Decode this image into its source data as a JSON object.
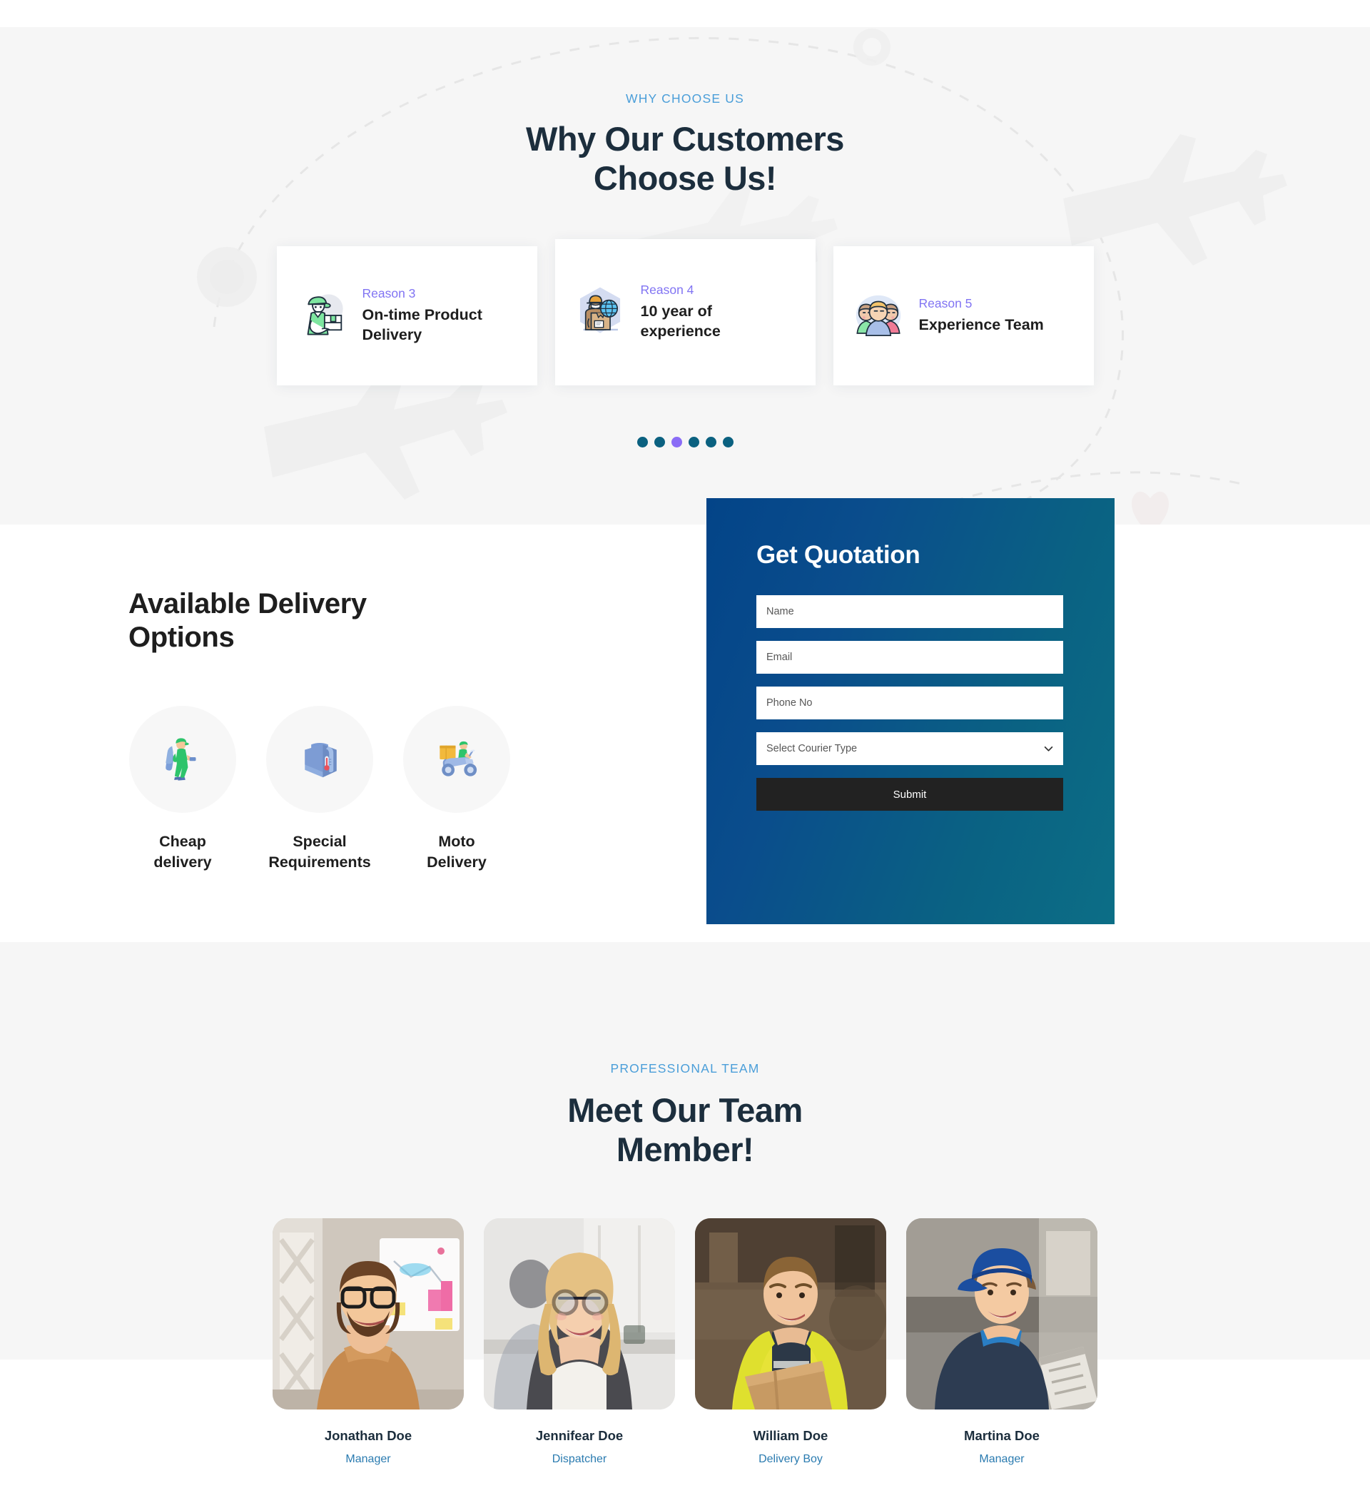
{
  "why_choose": {
    "eyebrow": "WHY CHOOSE US",
    "title_line1": "Why Our Customers",
    "title_line2": "Choose Us!",
    "cards": [
      {
        "label": "Reason 3",
        "title": "On-time Product Delivery",
        "icon": "courier-with-package-icon"
      },
      {
        "label": "Reason 4",
        "title": "10 year of experience",
        "icon": "worker-globe-package-icon"
      },
      {
        "label": "Reason 5",
        "title": "Experience Team",
        "icon": "team-people-icon"
      }
    ],
    "carousel": {
      "dot_count": 6,
      "active_index": 2,
      "dot_color": "#0b6180",
      "active_color": "#8a6cf6"
    }
  },
  "delivery_options": {
    "heading_line1": "Available Delivery",
    "heading_line2": "Options",
    "items": [
      {
        "label_line1": "Cheap",
        "label_line2": "delivery",
        "icon": "walking-courier-icon"
      },
      {
        "label_line1": "Special",
        "label_line2": "Requirements",
        "icon": "cooler-bag-icon"
      },
      {
        "label_line1": "Moto",
        "label_line2": "Delivery",
        "icon": "scooter-delivery-icon"
      }
    ]
  },
  "quotation": {
    "title": "Get Quotation",
    "fields": {
      "name_placeholder": "Name",
      "email_placeholder": "Email",
      "phone_placeholder": "Phone No",
      "courier_placeholder": "Select Courier Type"
    },
    "submit_label": "Submit",
    "gradient_from": "#034488",
    "gradient_to": "#0c6e86",
    "submit_bg": "#222222"
  },
  "team": {
    "eyebrow": "PROFESSIONAL TEAM",
    "title_line1": "Meet Our Team",
    "title_line2": "Member!",
    "members": [
      {
        "name": "Jonathan Doe",
        "role": "Manager",
        "photo": "bearded-man-glasses-office-photo"
      },
      {
        "name": "Jennifear Doe",
        "role": "Dispatcher",
        "photo": "blonde-woman-glasses-office-photo"
      },
      {
        "name": "William Doe",
        "role": "Delivery Boy",
        "photo": "man-hi-vis-vest-box-photo"
      },
      {
        "name": "Martina Doe",
        "role": "Manager",
        "photo": "woman-blue-cap-clipboard-photo"
      }
    ],
    "role_color": "#2a7bb0"
  }
}
